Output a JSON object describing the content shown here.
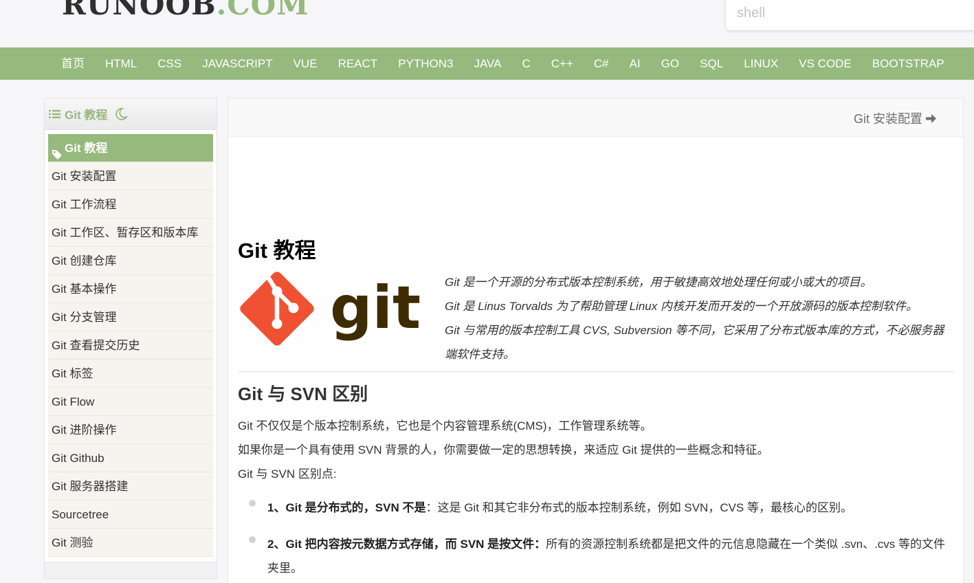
{
  "header": {
    "logo_main": "RUNOOB",
    "logo_tld": ".COM",
    "search_placeholder": "shell"
  },
  "nav": [
    "首页",
    "HTML",
    "CSS",
    "JAVASCRIPT",
    "VUE",
    "REACT",
    "PYTHON3",
    "JAVA",
    "C",
    "C++",
    "C#",
    "AI",
    "GO",
    "SQL",
    "LINUX",
    "VS CODE",
    "BOOTSTRAP"
  ],
  "sidebar": {
    "title": "Git 教程",
    "active": "Git 教程",
    "items": [
      "Git 安装配置",
      "Git 工作流程",
      "Git 工作区、暂存区和版本库",
      "Git 创建仓库",
      "Git 基本操作",
      "Git 分支管理",
      "Git 查看提交历史",
      "Git 标签",
      "Git Flow",
      "Git 进阶操作",
      "Git Github",
      "Git 服务器搭建",
      "Sourcetree",
      "Git 测验"
    ]
  },
  "main": {
    "next_label": "Git 安装配置",
    "title": "Git 教程",
    "logo_text": "git",
    "intro": [
      "Git 是一个开源的分布式版本控制系统，用于敏捷高效地处理任何或小或大的项目。",
      "Git 是 Linus Torvalds 为了帮助管理 Linux 内核开发而开发的一个开放源码的版本控制软件。",
      "Git 与常用的版本控制工具 CVS, Subversion 等不同，它采用了分布式版本库的方式，不必服务器端软件支持。"
    ],
    "section_title": "Git 与 SVN 区别",
    "paragraphs": [
      "Git 不仅仅是个版本控制系统，它也是个内容管理系统(CMS)，工作管理系统等。",
      "如果你是一个具有使用 SVN 背景的人，你需要做一定的思想转换，来适应 Git 提供的一些概念和特征。",
      "Git 与 SVN 区别点:"
    ],
    "bullets": [
      {
        "strong": "1、Git 是分布式的，SVN 不是",
        "text": "：这是 Git 和其它非分布式的版本控制系统，例如 SVN，CVS 等，最核心的区别。"
      },
      {
        "strong": "2、Git 把内容按元数据方式存储，而 SVN 是按文件：",
        "text": "所有的资源控制系统都是把文件的元信息隐藏在一个类似 .svn、.cvs 等的文件夹里。"
      }
    ]
  },
  "colors": {
    "accent": "#96b97d",
    "git_red": "#f05133",
    "git_dark": "#3e2c00"
  }
}
